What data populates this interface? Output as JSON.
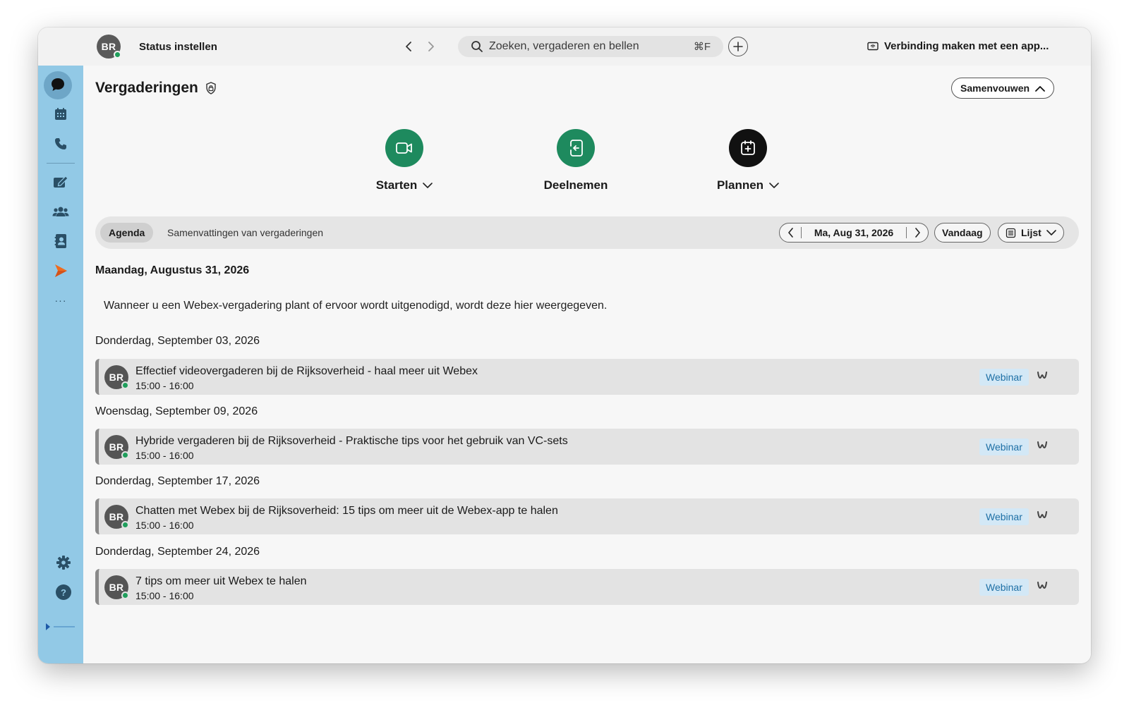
{
  "topbar": {
    "user_initials": "BR",
    "status_label": "Status instellen",
    "search_placeholder": "Zoeken, vergaderen en bellen",
    "search_shortcut": "⌘F",
    "connect_label": "Verbinding maken met een app..."
  },
  "sidebar": {
    "items": [
      "messaging-icon",
      "calendar-icon",
      "phone-icon",
      "whiteboard-icon",
      "teams-icon",
      "contacts-icon",
      "arrow-app-icon",
      "more-icon"
    ],
    "more_label": "···",
    "settings": "gear-icon",
    "help": "help-icon",
    "help_glyph": "?"
  },
  "main": {
    "title": "Vergaderingen",
    "collapse_label": "Samenvouwen",
    "actions": {
      "start": "Starten",
      "join": "Deelnemen",
      "schedule": "Plannen"
    },
    "tabs": {
      "agenda": "Agenda",
      "summaries": "Samenvattingen van vergaderingen"
    },
    "date_label": "Ma, Aug 31, 2026",
    "today_label": "Vandaag",
    "view_label": "Lijst",
    "today_heading": "Maandag, Augustus 31, 2026",
    "empty_message": "Wanneer u een Webex-vergadering plant of ervoor wordt uitgenodigd, wordt deze hier weergegeven.",
    "groups": [
      {
        "heading": "Donderdag, September 03, 2026",
        "meeting": {
          "initials": "BR",
          "title": "Effectief videovergaderen bij de Rijksoverheid - haal meer uit Webex",
          "time": "15:00  -  16:00",
          "badge": "Webinar"
        }
      },
      {
        "heading": "Woensdag, September 09, 2026",
        "meeting": {
          "initials": "BR",
          "title": "Hybride vergaderen bij de Rijksoverheid - Praktische tips voor het gebruik van VC-sets",
          "time": "15:00  -  16:00",
          "badge": "Webinar"
        }
      },
      {
        "heading": "Donderdag, September 17, 2026",
        "meeting": {
          "initials": "BR",
          "title": "Chatten met Webex bij de Rijksoverheid: 15 tips om meer uit de Webex-app te halen",
          "time": "15:00  -  16:00",
          "badge": "Webinar"
        }
      },
      {
        "heading": "Donderdag, September 24, 2026",
        "meeting": {
          "initials": "BR",
          "title": "7 tips om meer uit Webex te halen",
          "time": "15:00  -  16:00",
          "badge": "Webinar"
        }
      }
    ]
  },
  "colors": {
    "sidebar": "#92c9e6",
    "start_button": "#1e8a5e",
    "join_button": "#1e8a5e",
    "schedule_button": "#111111",
    "presence": "#1f9e5b",
    "webinar_badge_bg": "#d3e8f6",
    "webinar_badge_text": "#1d6fa5"
  }
}
